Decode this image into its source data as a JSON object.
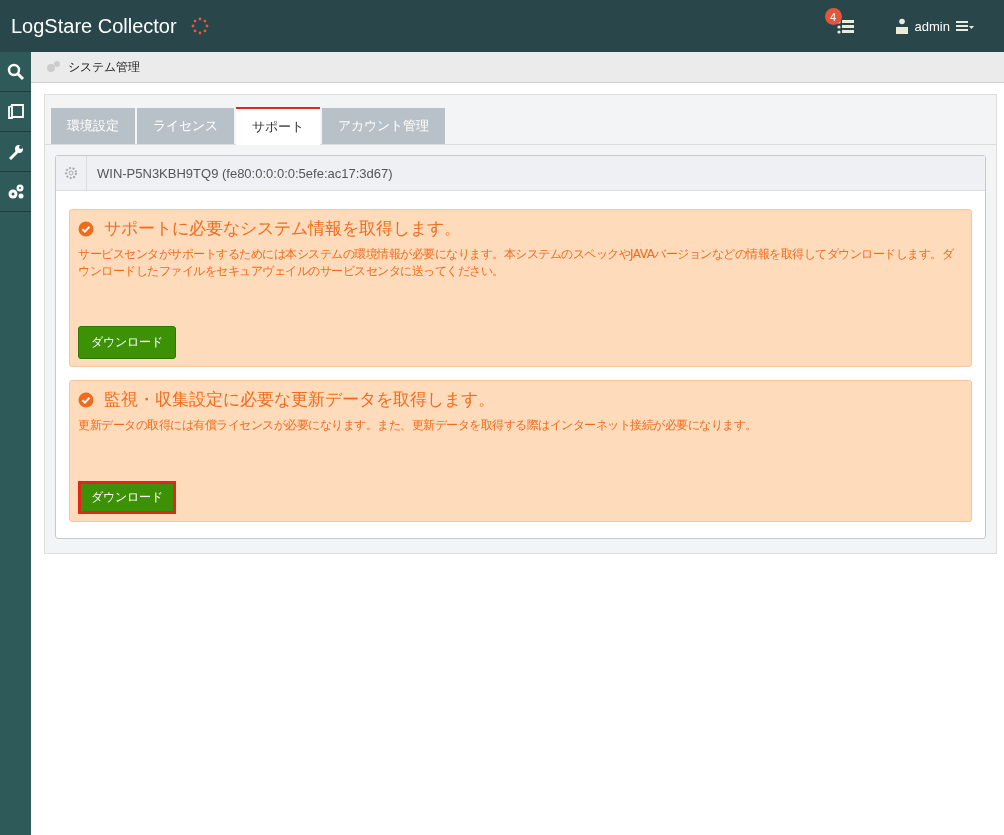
{
  "header": {
    "title": "LogStare Collector",
    "notification_count": "4",
    "user": "admin"
  },
  "sidebar": {
    "items": [
      {
        "kind": "search"
      },
      {
        "kind": "cards"
      },
      {
        "kind": "wrench"
      },
      {
        "kind": "gears"
      }
    ]
  },
  "breadcrumb": "システム管理",
  "tabs": [
    {
      "label": "環境設定",
      "selected": false
    },
    {
      "label": "ライセンス",
      "selected": false
    },
    {
      "label": "サポート",
      "selected": true
    },
    {
      "label": "アカウント管理",
      "selected": false
    }
  ],
  "panel": {
    "title": "WIN-P5N3KBH9TQ9 (fe80:0:0:0:0:5efe:ac17:3d67)"
  },
  "sections": [
    {
      "heading": "サポートに必要なシステム情報を取得します。",
      "description": "サービスセンタがサポートするためには本システムの環境情報が必要になります。本システムのスペックやJAVAバージョンなどの情報を取得してダウンロードします。ダウンロードしたファイルをセキュアヴェイルのサービスセンタに送ってください。",
      "button": "ダウンロード",
      "highlighted": false
    },
    {
      "heading": "監視・収集設定に必要な更新データを取得します。",
      "description": "更新データの取得には有償ライセンスが必要になります。また、更新データを取得する際はインターネット接続が必要になります。",
      "button": "ダウンロード",
      "highlighted": true
    }
  ]
}
